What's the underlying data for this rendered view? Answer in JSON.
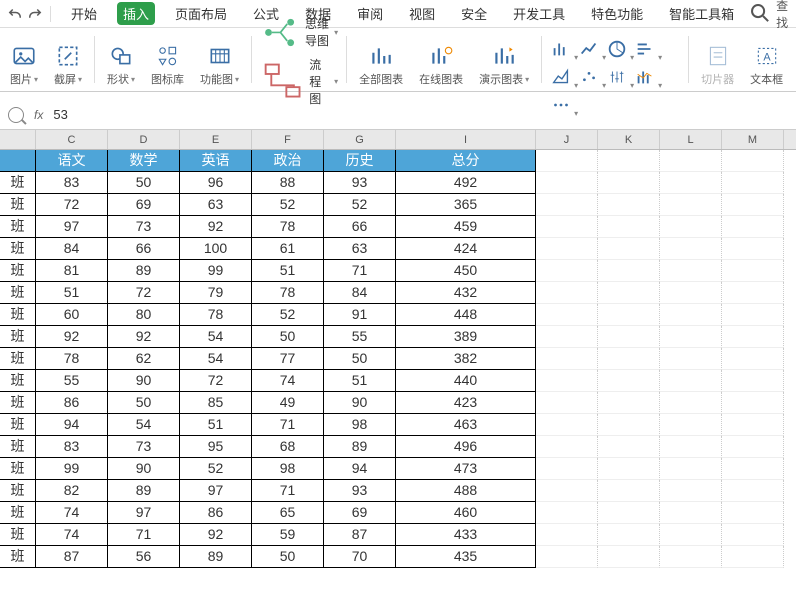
{
  "menu": {
    "tabs": [
      "开始",
      "插入",
      "页面布局",
      "公式",
      "数据",
      "审阅",
      "视图",
      "安全",
      "开发工具",
      "特色功能",
      "智能工具箱"
    ],
    "active": 1,
    "search": "查找"
  },
  "ribbon": {
    "groups": [
      {
        "id": "pic",
        "label": "图片"
      },
      {
        "id": "screenshot",
        "label": "截屏"
      },
      {
        "id": "shape",
        "label": "形状"
      },
      {
        "id": "iconlib",
        "label": "图标库"
      },
      {
        "id": "funcchart",
        "label": "功能图"
      },
      {
        "id": "mindmap",
        "label": "思维导图"
      },
      {
        "id": "flowchart",
        "label": "流程图"
      },
      {
        "id": "allchart",
        "label": "全部图表"
      },
      {
        "id": "onlinechart",
        "label": "在线图表"
      },
      {
        "id": "demochart",
        "label": "演示图表"
      },
      {
        "id": "slicer",
        "label": "切片器"
      },
      {
        "id": "textbox",
        "label": "文本框"
      }
    ]
  },
  "formula": {
    "value": "53"
  },
  "columns": [
    "C",
    "D",
    "E",
    "F",
    "G",
    "I",
    "J",
    "K",
    "L",
    "M"
  ],
  "headers": {
    "rowLabel": "",
    "C": "语文",
    "D": "数学",
    "E": "英语",
    "F": "政治",
    "G": "历史",
    "I": "总分"
  },
  "rowLabel": "班",
  "rows": [
    [
      83,
      50,
      96,
      88,
      93,
      492
    ],
    [
      72,
      69,
      63,
      52,
      52,
      365
    ],
    [
      97,
      73,
      92,
      78,
      66,
      459
    ],
    [
      84,
      66,
      100,
      61,
      63,
      424
    ],
    [
      81,
      89,
      99,
      51,
      71,
      450
    ],
    [
      51,
      72,
      79,
      78,
      84,
      432
    ],
    [
      60,
      80,
      78,
      52,
      91,
      448
    ],
    [
      92,
      92,
      54,
      50,
      55,
      389
    ],
    [
      78,
      62,
      54,
      77,
      50,
      382
    ],
    [
      55,
      90,
      72,
      74,
      51,
      440
    ],
    [
      86,
      50,
      85,
      49,
      90,
      423
    ],
    [
      94,
      54,
      51,
      71,
      98,
      463
    ],
    [
      83,
      73,
      95,
      68,
      89,
      496
    ],
    [
      99,
      90,
      52,
      98,
      94,
      473
    ],
    [
      82,
      89,
      97,
      71,
      93,
      488
    ],
    [
      74,
      97,
      86,
      65,
      69,
      460
    ],
    [
      74,
      71,
      92,
      59,
      87,
      433
    ],
    [
      87,
      56,
      89,
      50,
      70,
      435
    ]
  ]
}
